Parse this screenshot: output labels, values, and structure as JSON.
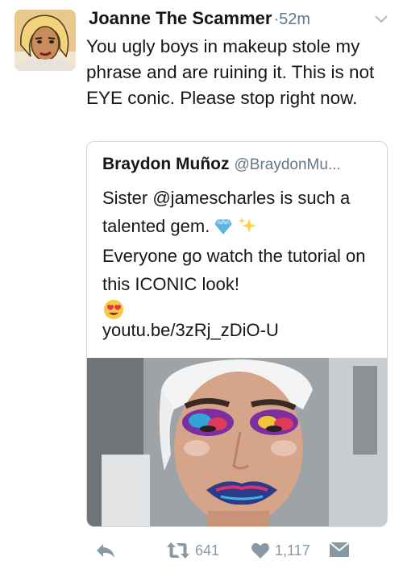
{
  "tweet": {
    "display_name": "Joanne The Scammer",
    "separator": "·",
    "time": "52m",
    "text": "You ugly boys in makeup stole my phrase and are ruining it. This is not EYE conic. Please stop right now."
  },
  "quoted": {
    "display_name": "Braydon Muñoz",
    "handle": "@BraydonMu...",
    "text_line1": "Sister @jamescharles is such a talented gem.",
    "text_line2": "Everyone go watch the tutorial on this ICONIC look!",
    "link": "youtu.be/3zRj_zDiO-U",
    "emojis": [
      "gem-emoji",
      "sparkles-emoji",
      "heart-eyes-emoji"
    ]
  },
  "actions": {
    "retweets": "641",
    "likes": "1,117",
    "icons": [
      "reply-icon",
      "retweet-icon",
      "like-icon",
      "direct-message-icon"
    ]
  },
  "colors": {
    "text": "#14171a",
    "secondary": "#657786",
    "action_gray": "#8899a6",
    "border": "#ccd6dd"
  }
}
